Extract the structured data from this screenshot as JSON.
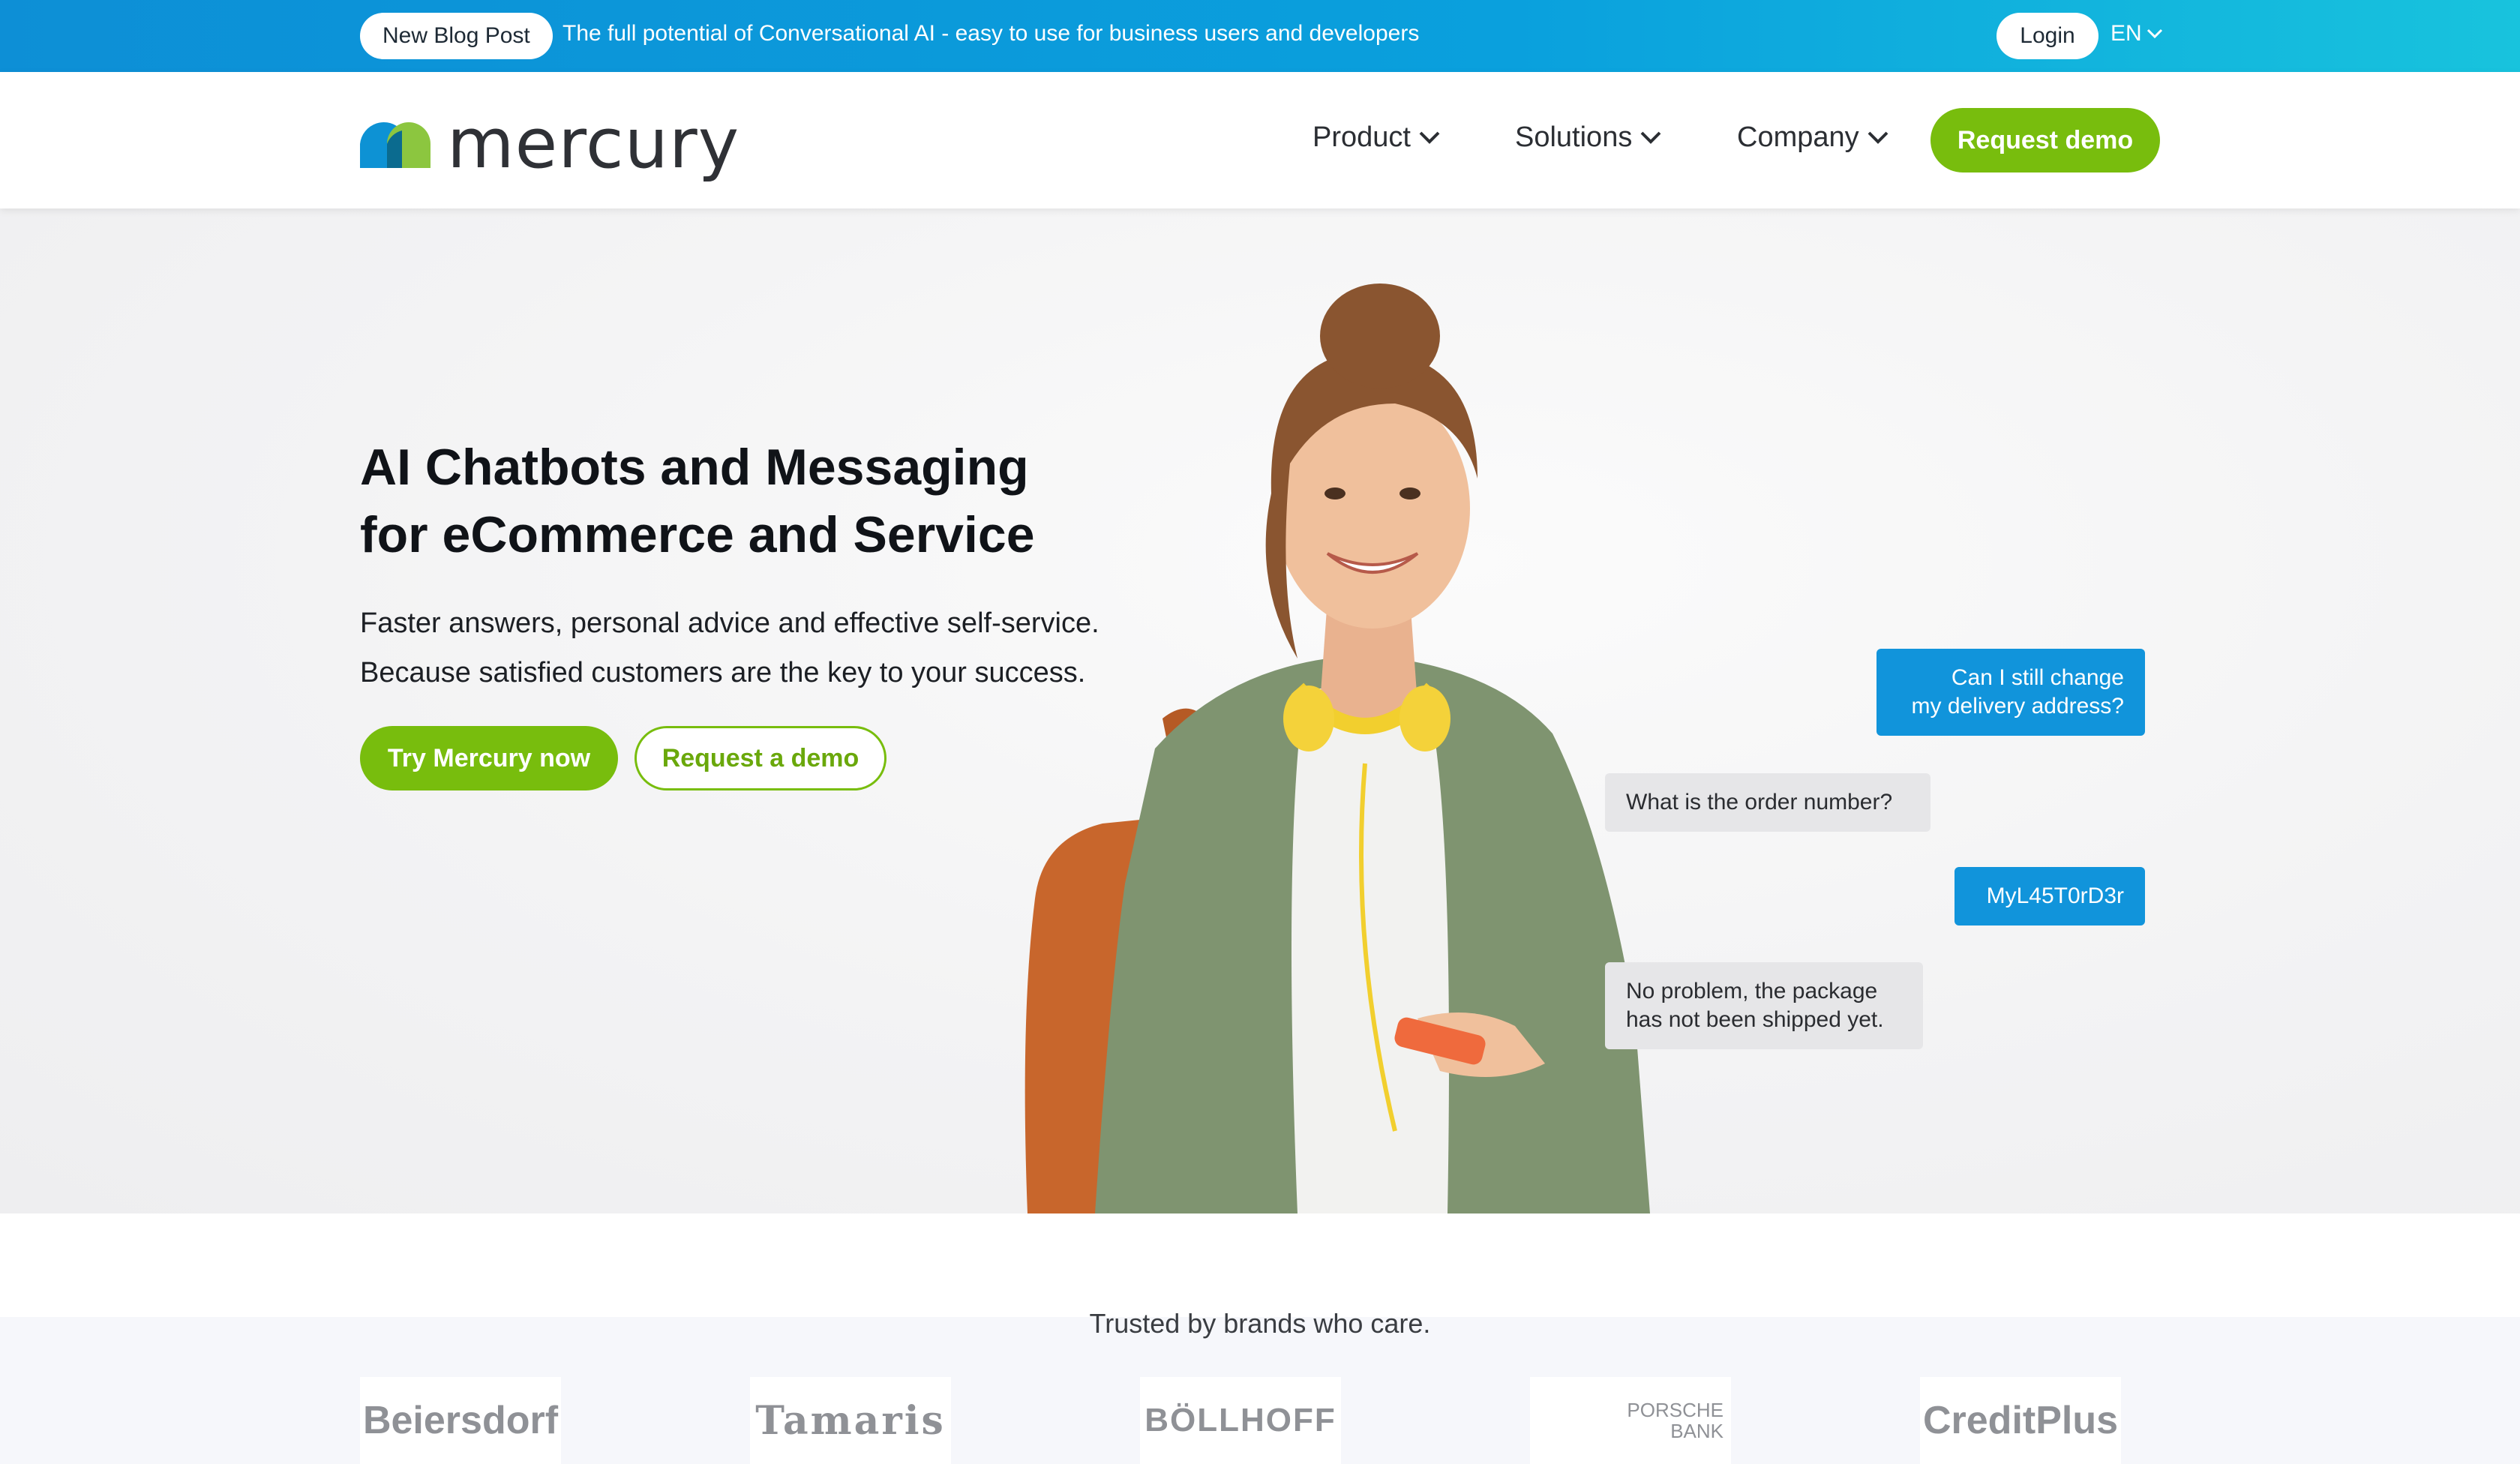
{
  "topbar": {
    "badge": "New Blog Post",
    "text": "The full potential of Conversational AI - easy to use for business users and developers",
    "login": "Login",
    "language": "EN"
  },
  "nav": {
    "brand": "mercury",
    "items": [
      {
        "label": "Product"
      },
      {
        "label": "Solutions"
      },
      {
        "label": "Company"
      }
    ],
    "cta": "Request demo"
  },
  "hero": {
    "title_line1": "AI Chatbots and Messaging",
    "title_line2": "for eCommerce and Service",
    "subtitle_line1": "Faster answers, personal advice and effective self-service.",
    "subtitle_line2": "Because satisfied customers are the key to your success.",
    "primary_button": "Try Mercury now",
    "secondary_button": "Request a demo"
  },
  "chat": [
    {
      "side": "customer",
      "line1": "Can I still change",
      "line2": "my delivery address?"
    },
    {
      "side": "bot",
      "line1": "What is the order number?",
      "line2": ""
    },
    {
      "side": "customer",
      "line1": "MyL45T0rD3r",
      "line2": ""
    },
    {
      "side": "bot",
      "line1": "No problem, the package",
      "line2": "has not been shipped yet."
    }
  ],
  "trusted": {
    "heading": "Trusted by brands who care.",
    "brands": [
      "Beiersdorf",
      "Tamaris",
      "BÖLLHOFF",
      "PORSCHE",
      "BANK",
      "CreditPlus"
    ]
  },
  "colors": {
    "accent_green": "#78bd0d",
    "topbar_blue": "#0aa0dd",
    "chat_blue": "#1194db"
  }
}
